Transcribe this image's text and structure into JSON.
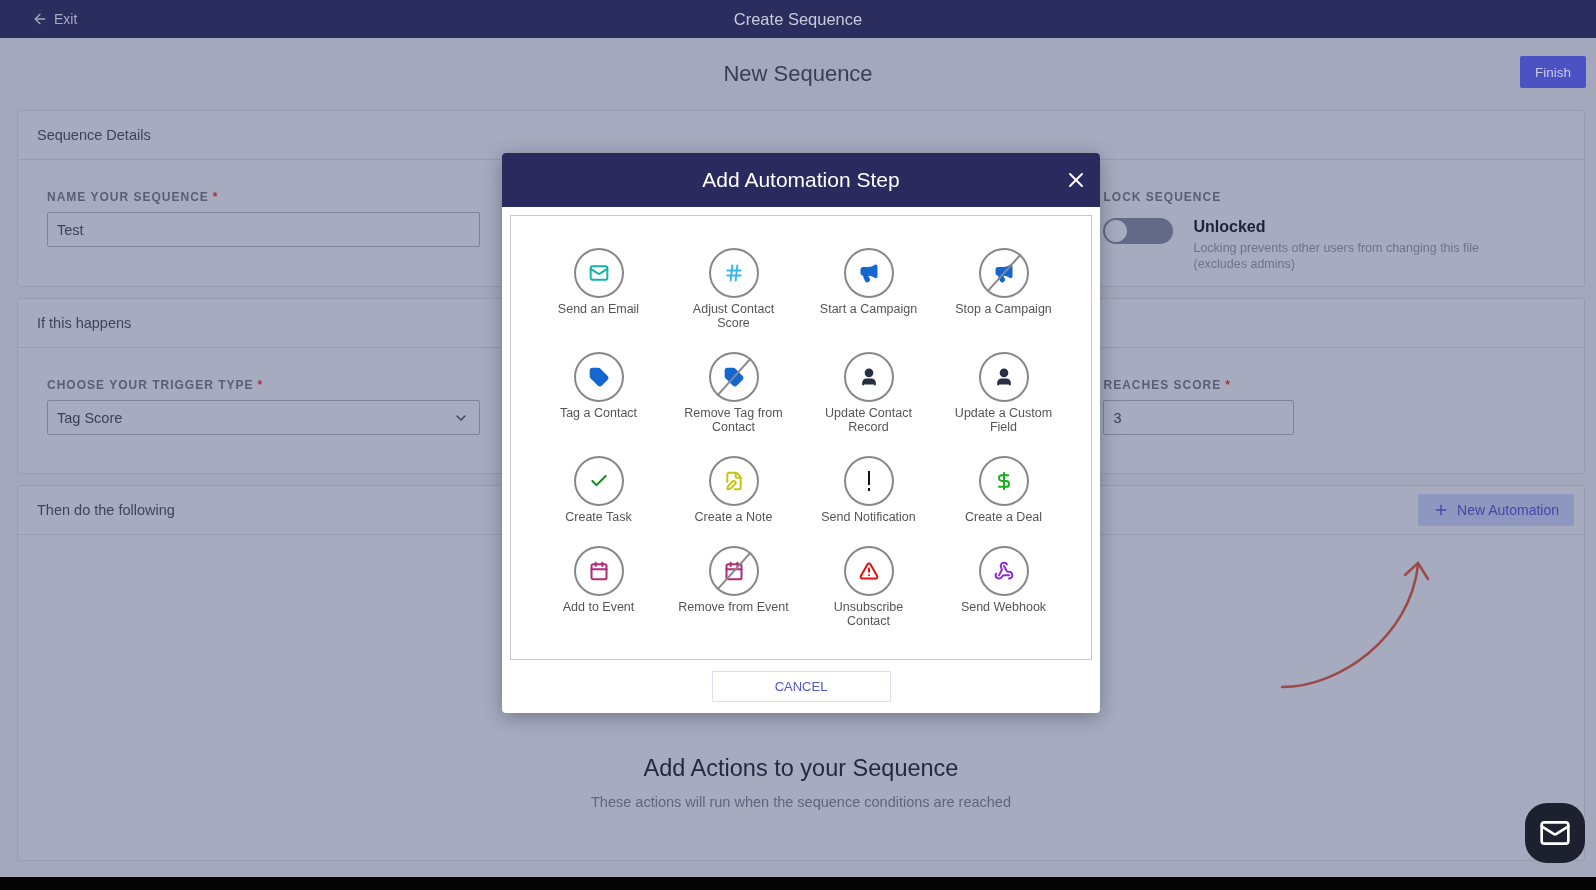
{
  "top_bar": {
    "exit": "Exit",
    "title": "Create Sequence"
  },
  "page": {
    "title": "New Sequence",
    "finish": "Finish"
  },
  "details_panel": {
    "header": "Sequence Details",
    "name_label": "NAME YOUR SEQUENCE",
    "name_required": "*",
    "name_value": "Test",
    "lock_label": "LOCK SEQUENCE",
    "lock": {
      "on": false,
      "status": "Unlocked",
      "hint": "Locking prevents other users from changing this file (excludes admins)"
    }
  },
  "trigger_panel": {
    "header": "If this happens",
    "trigger_label": "CHOOSE YOUR TRIGGER TYPE",
    "trigger_required": "*",
    "trigger_value": "Tag Score",
    "score_label": "REACHES SCORE",
    "score_required": "*",
    "score_value": "3"
  },
  "actions_panel": {
    "header": "Then do the following",
    "new_button": "New Automation",
    "empty_title": "Add Actions to your Sequence",
    "empty_text": "These actions will run when the sequence conditions are reached"
  },
  "modal": {
    "title": "Add Automation Step",
    "cancel": "CANCEL",
    "steps": [
      {
        "label": "Send an Email",
        "kind": "email",
        "crossed": false
      },
      {
        "label": "Adjust Contact Score",
        "kind": "score",
        "crossed": false
      },
      {
        "label": "Start a Campaign",
        "kind": "campaign",
        "crossed": false
      },
      {
        "label": "Stop a Campaign",
        "kind": "campaign",
        "crossed": true
      },
      {
        "label": "Tag a Contact",
        "kind": "tag",
        "crossed": false
      },
      {
        "label": "Remove Tag from Contact",
        "kind": "tag",
        "crossed": true
      },
      {
        "label": "Update Contact Record",
        "kind": "contact",
        "crossed": false
      },
      {
        "label": "Update a Custom Field",
        "kind": "contact",
        "crossed": false
      },
      {
        "label": "Create Task",
        "kind": "task",
        "crossed": false
      },
      {
        "label": "Create a Note",
        "kind": "note",
        "crossed": false
      },
      {
        "label": "Send Notification",
        "kind": "notification",
        "crossed": false
      },
      {
        "label": "Create a Deal",
        "kind": "deal",
        "crossed": false
      },
      {
        "label": "Add to Event",
        "kind": "event",
        "crossed": false
      },
      {
        "label": "Remove from Event",
        "kind": "event",
        "crossed": true
      },
      {
        "label": "Unsubscribe Contact",
        "kind": "unsubscribe",
        "crossed": false
      },
      {
        "label": "Send Webhook",
        "kind": "webhook",
        "crossed": false
      }
    ]
  }
}
